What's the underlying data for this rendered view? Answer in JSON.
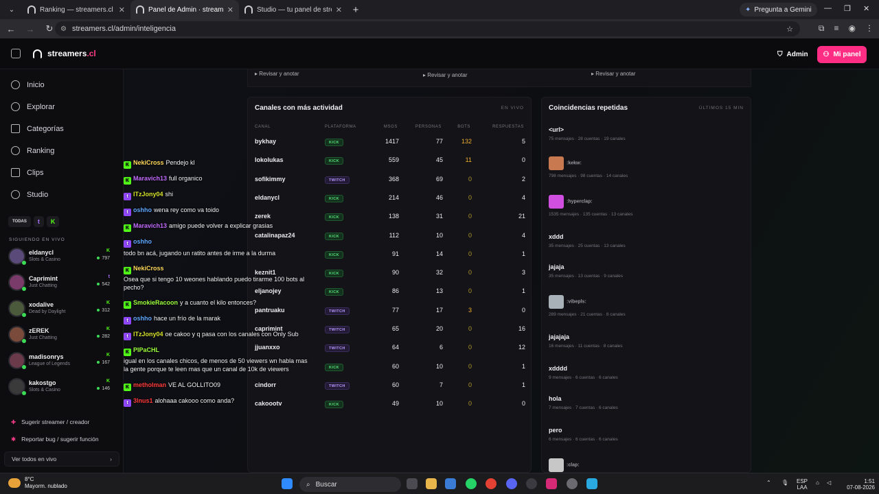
{
  "browser": {
    "tabs": [
      {
        "title": "Ranking — streamers.cl · stream"
      },
      {
        "title": "Panel de Admin · streamers.cl"
      },
      {
        "title": "Studio — tu panel de streamer"
      }
    ],
    "gemini": "Pregunta a Gemini",
    "url": "streamers.cl/admin/inteligencia"
  },
  "header": {
    "brand_main": "streamers",
    "brand_tld": ".cl",
    "admin": "Admin",
    "mipanel": "Mi panel"
  },
  "sidebar": {
    "nav": [
      "Inicio",
      "Explorar",
      "Categorías",
      "Ranking",
      "Clips",
      "Studio"
    ],
    "filters": {
      "all": "TODAS",
      "twitch": "t",
      "kick": "K"
    },
    "following_label": "SIGUIENDO EN VIVO",
    "streamers": [
      {
        "name": "eldanycl",
        "category": "Slots & Casino",
        "platform": "K",
        "viewers": "797",
        "color": "#53fc18"
      },
      {
        "name": "Caprimint",
        "category": "Just Chatting",
        "platform": "t",
        "viewers": "542",
        "color": "#a970ff"
      },
      {
        "name": "xodalive",
        "category": "Dead by Daylight",
        "platform": "K",
        "viewers": "312",
        "color": "#53fc18"
      },
      {
        "name": "zEREK",
        "category": "Just Chatting",
        "platform": "K",
        "viewers": "282",
        "color": "#53fc18"
      },
      {
        "name": "madisonrys",
        "category": "League of Legends",
        "platform": "K",
        "viewers": "167",
        "color": "#53fc18"
      },
      {
        "name": "kakostgo",
        "category": "Slots & Casino",
        "platform": "K",
        "viewers": "146",
        "color": "#53fc18"
      }
    ],
    "suggest": "Sugerir streamer / creador",
    "report": "Reportar bug / sugerir función",
    "seeall": "Ver todos en vivo"
  },
  "review": [
    "Revisar y anotar",
    "Revisar y anotar",
    "Revisar y anotar"
  ],
  "activity": {
    "title": "Canales con más actividad",
    "tag": "EN VIVO",
    "headers": [
      "CANAL",
      "PLATAFORMA",
      "MSGS",
      "PERSONAS",
      "BOTS",
      "RESPUESTAS"
    ],
    "rows": [
      {
        "canal": "bykhay",
        "plat": "KICK",
        "msgs": "1417",
        "personas": "77",
        "bots": "132",
        "resp": "5"
      },
      {
        "canal": "lokolukas",
        "plat": "KICK",
        "msgs": "559",
        "personas": "45",
        "bots": "11",
        "resp": "0"
      },
      {
        "canal": "sofikimmy",
        "plat": "TWITCH",
        "msgs": "368",
        "personas": "69",
        "bots": "0",
        "resp": "2"
      },
      {
        "canal": "eldanycl",
        "plat": "KICK",
        "msgs": "214",
        "personas": "46",
        "bots": "0",
        "resp": "4"
      },
      {
        "canal": "zerek",
        "plat": "KICK",
        "msgs": "138",
        "personas": "31",
        "bots": "0",
        "resp": "21"
      },
      {
        "canal": "catalinapaz24",
        "plat": "KICK",
        "msgs": "112",
        "personas": "10",
        "bots": "0",
        "resp": "4"
      },
      {
        "canal": "",
        "plat": "KICK",
        "msgs": "91",
        "personas": "14",
        "bots": "0",
        "resp": "1"
      },
      {
        "canal": "keznit1",
        "plat": "KICK",
        "msgs": "90",
        "personas": "32",
        "bots": "0",
        "resp": "3"
      },
      {
        "canal": "eljanojey",
        "plat": "KICK",
        "msgs": "86",
        "personas": "13",
        "bots": "0",
        "resp": "1"
      },
      {
        "canal": "pantruaku",
        "plat": "TWITCH",
        "msgs": "77",
        "personas": "17",
        "bots": "3",
        "resp": "0"
      },
      {
        "canal": "caprimint",
        "plat": "TWITCH",
        "msgs": "65",
        "personas": "20",
        "bots": "0",
        "resp": "16"
      },
      {
        "canal": "jjuanxxo",
        "plat": "TWITCH",
        "msgs": "64",
        "personas": "6",
        "bots": "0",
        "resp": "12"
      },
      {
        "canal": "",
        "plat": "KICK",
        "msgs": "60",
        "personas": "10",
        "bots": "0",
        "resp": "1"
      },
      {
        "canal": "cindorr",
        "plat": "TWITCH",
        "msgs": "60",
        "personas": "7",
        "bots": "0",
        "resp": "1"
      },
      {
        "canal": "cakoootv",
        "plat": "KICK",
        "msgs": "49",
        "personas": "10",
        "bots": "0",
        "resp": "0"
      }
    ]
  },
  "coincidences": {
    "title": "Coincidencias repetidas",
    "tag": "ÚLTIMOS 15 MIN",
    "items": [
      {
        "name": "<url>",
        "emote": "",
        "meta": "75 mensajes · 28 cuentas · 19 canales",
        "color": ""
      },
      {
        "name": "",
        "emote": ":kekw:",
        "meta": "798 mensajes · 98 cuentas · 14 canales",
        "color": "#c9794f"
      },
      {
        "name": "",
        "emote": ":hyperclap:",
        "meta": "1535 mensajes · 135 cuentas · 13 canales",
        "color": "#d04fe0"
      },
      {
        "name": "xddd",
        "emote": "",
        "meta": "35 mensajes · 25 cuentas · 13 canales",
        "color": ""
      },
      {
        "name": "jajaja",
        "emote": "",
        "meta": "35 mensajes · 13 cuentas · 9 canales",
        "color": ""
      },
      {
        "name": "",
        "emote": ":vibepls:",
        "meta": "289 mensajes · 21 cuentas · 8 canales",
        "color": "#a8b0b8"
      },
      {
        "name": "jajajaja",
        "emote": "",
        "meta": "16 mensajes · 11 cuentas · 8 canales",
        "color": ""
      },
      {
        "name": "xdddd",
        "emote": "",
        "meta": "9 mensajes · 6 cuentas · 6 canales",
        "color": ""
      },
      {
        "name": "hola",
        "emote": "",
        "meta": "7 mensajes · 7 cuentas · 6 canales",
        "color": ""
      },
      {
        "name": "pero",
        "emote": "",
        "meta": "6 mensajes · 6 cuentas · 6 canales",
        "color": ""
      },
      {
        "name": "",
        "emote": ":clap:",
        "meta": "",
        "color": "#c7c7c7"
      }
    ]
  },
  "chat": [
    {
      "p": "k",
      "user": "NekiCross",
      "color": "#ffd95a",
      "msg": "Pendejo kl"
    },
    {
      "p": "k",
      "user": "Maravich13",
      "color": "#c46cff",
      "msg": "full organico"
    },
    {
      "p": "t",
      "user": "ITzJony04",
      "color": "#d6e22a",
      "msg": "shi"
    },
    {
      "p": "t",
      "user": "oshho",
      "color": "#5fa8ff",
      "msg": "wena rey como va toido"
    },
    {
      "p": "k",
      "user": "Maravich13",
      "color": "#c46cff",
      "msg": "amigo puede volver a explicar grasias"
    },
    {
      "p": "t",
      "user": "oshho",
      "color": "#5fa8ff",
      "msg": ""
    },
    {
      "p": "",
      "user": "",
      "color": "",
      "msg": "todo bn acá, jugando un ratito antes de irme a la durma"
    },
    {
      "p": "k",
      "user": "NekiCross",
      "color": "#ffd95a",
      "msg": ""
    },
    {
      "p": "",
      "user": "",
      "color": "",
      "msg": "Osea que si tengo 10 weones hablando puedo tirarme 100 bots al pecho?"
    },
    {
      "p": "k",
      "user": "SmokieRacoon",
      "color": "#9cff3d",
      "msg": "y a cuanto el kilo entonces?"
    },
    {
      "p": "t",
      "user": "oshho",
      "color": "#5fa8ff",
      "msg": "hace un frío de la marak"
    },
    {
      "p": "t",
      "user": "ITzJony04",
      "color": "#d6e22a",
      "msg": "oe cakoo y q pasa con los canales con Only Sub"
    },
    {
      "p": "k",
      "user": "PIPaCHL",
      "color": "#9cff3d",
      "msg": ""
    },
    {
      "p": "",
      "user": "",
      "color": "",
      "msg": "igual en los canales chicos, de menos de 50 viewers wn habla mas la gente porque te leen mas que un canal de 10k de viewers"
    },
    {
      "p": "k",
      "user": "metholman",
      "color": "#ff3b3b",
      "msg": "VE AL GOLLITO09"
    },
    {
      "p": "t",
      "user": "3lnus1",
      "color": "#ff3b3b",
      "msg": "alohaaa cakooo como anda?"
    }
  ],
  "taskbar": {
    "temp": "8°C",
    "weather": "Mayorm. nublado",
    "search": "Buscar",
    "lang1": "ESP",
    "lang2": "LAA",
    "time": "1:51",
    "date": "07-08-2026"
  }
}
